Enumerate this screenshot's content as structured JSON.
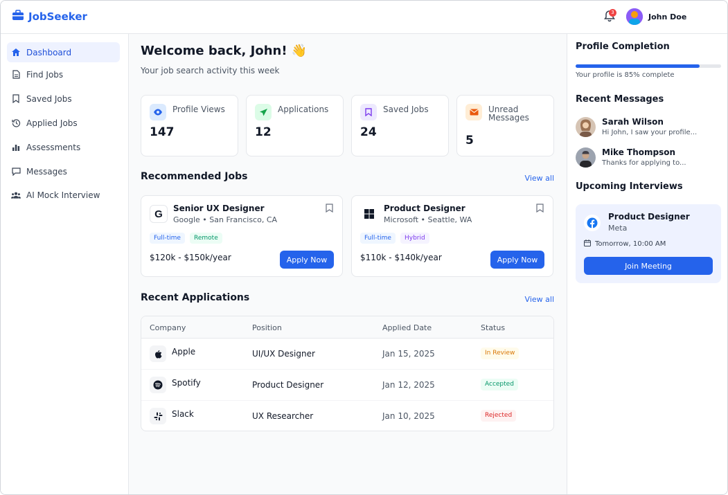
{
  "app": {
    "name": "JobSeeker",
    "brand_color": "#2563eb"
  },
  "header": {
    "notification_count": "3",
    "user_name": "John Doe"
  },
  "sidebar": {
    "items": [
      {
        "label": "Dashboard",
        "icon": "home-icon",
        "active": true
      },
      {
        "label": "Find Jobs",
        "icon": "document-icon"
      },
      {
        "label": "Saved Jobs",
        "icon": "bookmark-icon"
      },
      {
        "label": "Applied Jobs",
        "icon": "history-icon"
      },
      {
        "label": "Assessments",
        "icon": "bar-chart-icon"
      },
      {
        "label": "Messages",
        "icon": "chat-icon"
      },
      {
        "label": "AI Mock Interview",
        "icon": "users-icon"
      }
    ]
  },
  "main": {
    "welcome": "Welcome back, John! 👋",
    "subtitle": "Your job search activity this week",
    "stats": [
      {
        "label": "Profile Views",
        "value": "147",
        "icon": "eye-icon",
        "color": "#2563eb",
        "bg": "#dbeafe"
      },
      {
        "label": "Applications",
        "value": "12",
        "icon": "send-icon",
        "color": "#16a34a",
        "bg": "#dcfce7"
      },
      {
        "label": "Saved Jobs",
        "value": "24",
        "icon": "bookmark-icon",
        "color": "#7c3aed",
        "bg": "#ede9fe"
      },
      {
        "label": "Unread Messages",
        "value": "5",
        "icon": "mail-icon",
        "color": "#ea580c",
        "bg": "#ffedd5"
      }
    ],
    "recommended": {
      "title": "Recommended Jobs",
      "view_all": "View all",
      "jobs": [
        {
          "title": "Senior UX Designer",
          "meta": "Google • San Francisco, CA",
          "logo": "google-icon",
          "tags": [
            "Full-time",
            "Remote"
          ],
          "salary": "$120k - $150k/year",
          "apply": "Apply Now"
        },
        {
          "title": "Product Designer",
          "meta": "Microsoft • Seattle, WA",
          "logo": "microsoft-icon",
          "tags": [
            "Full-time",
            "Hybrid"
          ],
          "salary": "$110k - $140k/year",
          "apply": "Apply Now"
        }
      ]
    },
    "applications": {
      "title": "Recent Applications",
      "view_all": "View all",
      "columns": [
        "Company",
        "Position",
        "Applied Date",
        "Status"
      ],
      "rows": [
        {
          "company": "Apple",
          "position": "UI/UX Designer",
          "date": "Jan 15, 2025",
          "status": "In Review",
          "logo": "apple-icon"
        },
        {
          "company": "Spotify",
          "position": "Product Designer",
          "date": "Jan 12, 2025",
          "status": "Accepted",
          "logo": "spotify-icon"
        },
        {
          "company": "Slack",
          "position": "UX Researcher",
          "date": "Jan 10, 2025",
          "status": "Rejected",
          "logo": "slack-icon"
        }
      ]
    }
  },
  "right": {
    "profile": {
      "title": "Profile Completion",
      "percent": 85,
      "text": "Your profile is 85% complete"
    },
    "messages": {
      "title": "Recent Messages",
      "items": [
        {
          "name": "Sarah Wilson",
          "preview": "Hi John, I saw your profile..."
        },
        {
          "name": "Mike Thompson",
          "preview": "Thanks for applying to..."
        }
      ]
    },
    "interviews": {
      "title": "Upcoming Interviews",
      "role": "Product Designer",
      "company": "Meta",
      "time": "Tomorrow, 10:00 AM",
      "join": "Join Meeting"
    }
  }
}
